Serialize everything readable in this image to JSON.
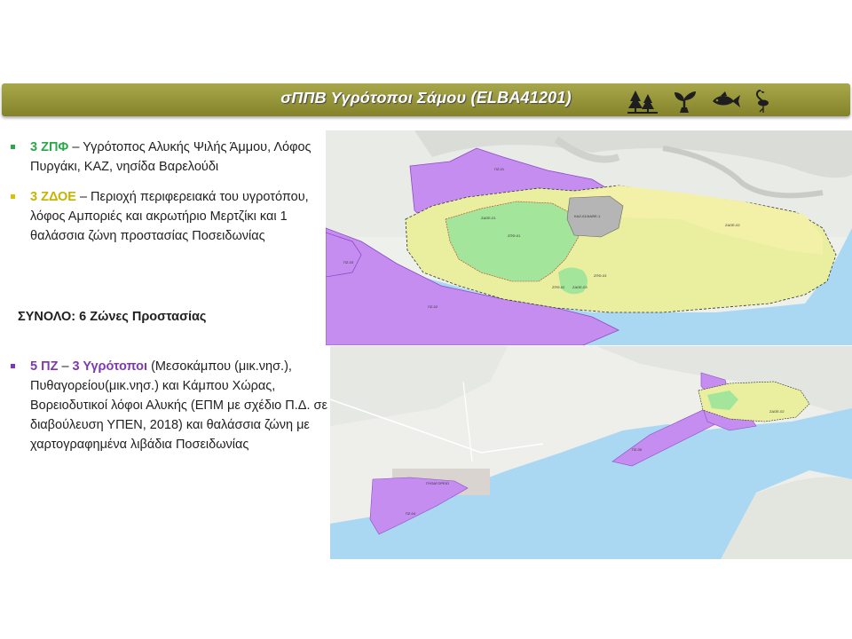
{
  "title": "σΠΠΒ Υγρότοποι Σάμου (ELBA41201)",
  "header_icons": [
    "trees-icon",
    "plant-icon",
    "fish-icon",
    "flamingo-icon"
  ],
  "colors": {
    "title_bar": "#93912f",
    "zpf_green": "#2aa84a",
    "zdoe_yellow": "#c5b400",
    "pz_purple": "#7e38b7",
    "map_sea": "#aad7f2",
    "map_zone_purple": "#c58df0",
    "map_zone_yellow": "#f3f0a7",
    "map_zone_green": "#a3e59a"
  },
  "bullets": [
    {
      "head": "3 ΖΠΦ",
      "text": " – Υγρότοπος Αλυκής Ψιλής Άμμου, Λόφος Πυργάκι, ΚΑΖ, νησίδα Βαρελούδι",
      "color": "green"
    },
    {
      "head": "3 ΖΔΟΕ",
      "text": " – Περιοχή περιφερειακά του υγροτόπου, λόφος Αμποριές και ακρωτήριο Μερτζίκι και 1 θαλάσσια ζώνη προστασίας Ποσειδωνίας",
      "color": "yellow"
    }
  ],
  "total": "ΣΥΝΟΛΟ: 6 Ζώνες Προστασίας",
  "pz_item": {
    "head1": "5 ΠΖ",
    "sep": " – ",
    "head2": "3 Υγρότοποι",
    "text": " (Μεσοκάμπου (μικ.νησ.), Πυθαγορείου(μικ.νησ.) και Κάμπου Χώρας, Βορειοδυτικοί λόφοι Αλυκής (ΕΠΜ με σχέδιο Π.Δ. σε διαβούλευση ΥΠΕΝ, 2018) και θαλάσσια ζώνη με χαρτογραφημένα λιβάδια Ποσειδωνίας"
  },
  "map_labels": {
    "pz01": "ΠΖ-01",
    "pz02": "ΠΖ-02",
    "pz03": "ΠΖ-03",
    "pz04": "ΠΖ-04",
    "pz05": "ΠΖ-05",
    "zpf01": "ΖΠΦ-01",
    "zpf02": "ΖΠΦ-02",
    "zpf03": "ΖΠΦ-03",
    "zdoe01": "ΖΔΟΕ-01",
    "zdoe02": "ΖΔΟΕ-02",
    "zdoe03": "ΖΔΟΕ-03",
    "kaz": "ΚΑΖ-01/ΑΑΘΕ-1",
    "town": "ΠΥΘΑΓΟΡΕΙΟ"
  }
}
